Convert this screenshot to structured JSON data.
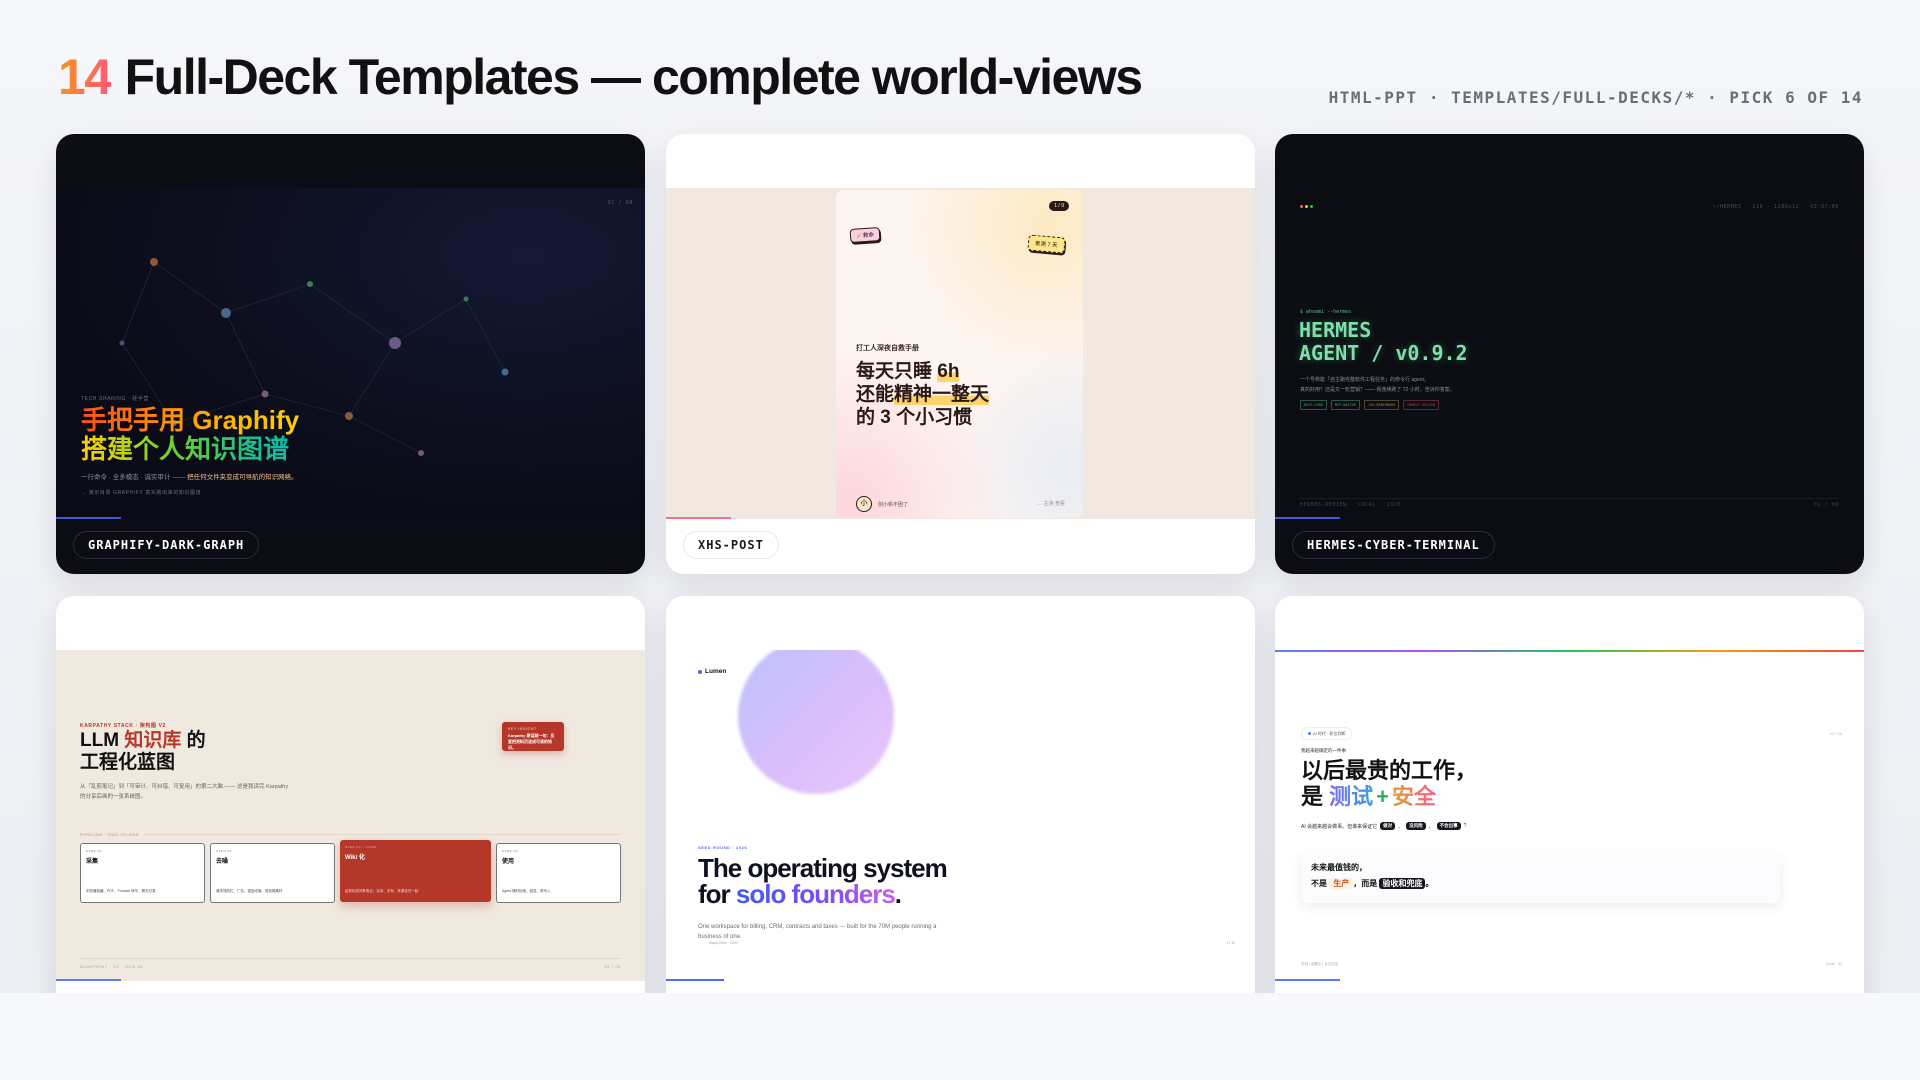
{
  "header": {
    "count": "14",
    "title": "Full-Deck Templates — complete world-views",
    "breadcrumb": "HTML-PPT · TEMPLATES/FULL-DECKS/* · PICK 6 OF 14"
  },
  "cards": [
    {
      "label": "GRAPHIFY-DARK-GRAPH",
      "slide": {
        "page": "01 / 08",
        "kicker": "TECH SHARING · 硅手营",
        "title_a": "手把手用 Graphify",
        "title_b": "搭建个人知识图谱",
        "subtitle_a": "一行命令 · 全多模态 · 诚实审计 —— ",
        "subtitle_b": "把任何文件夹变成可导航的知识网络。",
        "footnote": "→ 演示目录 GRAPHIFY 真实跑出来的知识图谱",
        "accent": "#3b5bdb"
      }
    },
    {
      "label": "XHS-POST",
      "slide": {
        "page": "1 / 9",
        "sticker_left": "🪄救命",
        "sticker_right": "亲测 7 天",
        "kicker": "打工人深夜自救手册",
        "line1": "每天只睡 ",
        "line1_hl": "6h",
        "line2": "还能",
        "line2_hl": "精神一整天",
        "line3": "的 3 个小习惯",
        "avatar": "小",
        "author": "剑小帆不困了",
        "action": "← 左滑 查看",
        "accent": "#ff6b8a"
      }
    },
    {
      "label": "HERMES-CYBER-TERMINAL",
      "slide": {
        "status": "~/HERMES · 218 · 1280x12 · 03:37:06",
        "prompt": "$ whoami --hermes",
        "title_a": "HERMES",
        "title_b": "AGENT / v0.9.2",
        "desc_a": "一个号称能「自主跑完整软件工程任务」的命令行 agent。",
        "desc_b": "真的好用？还是又一轮营销？—— 我连续跑了 72 小时，告诉你答案。",
        "tags": [
          "RUST-CORE",
          "MCP-NATIVE",
          "72H-BENCHMARK",
          "HONEST-REVIEW"
        ],
        "footer": "HERMES-REVIEW · LOCAL · 2026",
        "page": "01 / 06",
        "accent": "#6ee7a8"
      }
    },
    {
      "label": "",
      "slide": {
        "kicker": "KARPATHY STACK · 架构图 V2",
        "title_a": "LLM ",
        "title_hl": "知识库",
        "title_b": " 的",
        "title_c": "工程化蓝图",
        "desc": "从「乱剪笔记」到「可审计、可纠错、可复用」的第二大脑 —— 这是我读完 Karpathy 的分享后画的一张系统图。",
        "insight_kicker": "KEY INSIGHT",
        "insight": "Karpathy 原话就一句：反复把资料沉淀成可读的知识。",
        "pipeline": "PIPELINE · END-TO-END",
        "steps": [
          {
            "n": "STEP 01",
            "t": "采集",
            "d": "浏览器剪藏、PDF、Podcast 转写、聊天记录"
          },
          {
            "n": "STEP 02",
            "t": "去噪",
            "d": "清洗导航栏、广告、重复段落、低信噪素材"
          },
          {
            "n": "STEP 03 · CORE",
            "t": "Wiki 化",
            "d": "结构化成词条笔记，实体、关系、来源全在一起"
          },
          {
            "n": "STEP 04",
            "t": "使用",
            "d": "Agent 随时检索、回答、再写入"
          }
        ],
        "footer": "BLUEPRINT · V2 · 2026.04",
        "page": "01 / 08",
        "accent": "#b5372a"
      }
    },
    {
      "label": "",
      "slide": {
        "brand": "Lumen",
        "kicker": "SEED ROUND · 2026",
        "title_a": "The operating system",
        "title_b": "for ",
        "title_hl": "solo founders",
        "title_c": ".",
        "desc": "One workspace for billing, CRM, contracts and taxes — built for the 70M people running a business of one.",
        "presenter": "Maya Chen · CEO",
        "page": "1 / 10",
        "accent": "#4f46e5"
      }
    },
    {
      "label": "",
      "slide": {
        "pill": "AI 时代 · 职业判断",
        "page": "01 / 08",
        "kicker": "我越来越确定的一件事",
        "title_a": "以后最贵的工作，",
        "title_b": "是 ",
        "hl1": "测试",
        "plus": "+",
        "hl2": "安全",
        "sub": "AI 会越来越会做事。但谁来保证它",
        "tags": [
          "做对",
          "没风险",
          "不会出事"
        ],
        "q1": "未来最值钱的，",
        "q2a": "不是 ",
        "q2_hl": "生产",
        "q2b": "，而是 ",
        "q2_dark": "验收和兜底",
        "q2c": "。",
        "footer": "内测 | 观察点 | 长文沉淀",
        "footer_right": "Cover · 01",
        "accent": "#5b7cfa"
      }
    }
  ]
}
